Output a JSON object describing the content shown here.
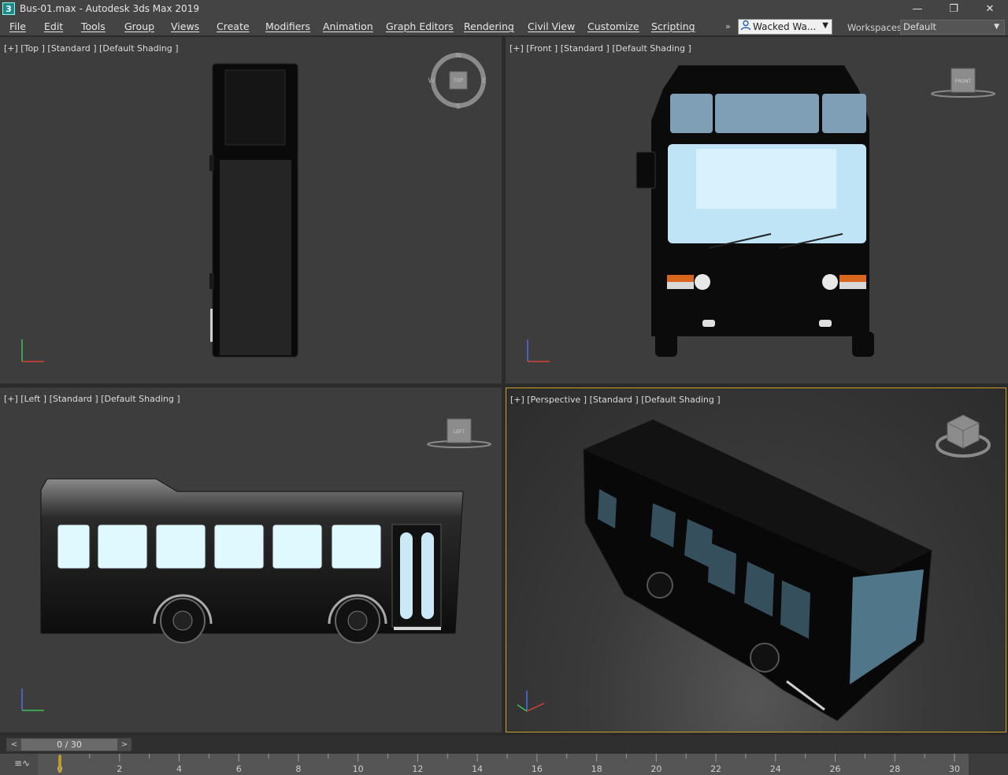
{
  "window": {
    "app_icon_glyph": "3",
    "title": "Bus-01.max - Autodesk 3ds Max 2019",
    "controls": {
      "minimize": "—",
      "maximize": "❐",
      "close": "✕"
    }
  },
  "menu": {
    "items": [
      "File",
      "Edit",
      "Tools",
      "Group",
      "Views",
      "Create",
      "Modifiers",
      "Animation",
      "Graph Editors",
      "Rendering",
      "Civil View",
      "Customize",
      "Scripting"
    ],
    "more": "»",
    "user": "Wacked Wa...",
    "workspaces_label": "Workspaces:",
    "workspace_value": "Default"
  },
  "viewports": {
    "top": {
      "label": "[+] [Top ] [Standard ] [Default Shading ]",
      "gizmo": {
        "n": "N",
        "s": "S",
        "e": "E",
        "w": "W",
        "face": "TOP"
      }
    },
    "front": {
      "label": "[+] [Front ] [Standard ] [Default Shading ]",
      "gizmo_face": "FRONT"
    },
    "left": {
      "label": "[+] [Left ] [Standard ] [Default Shading ]",
      "gizmo_face": "LEFT"
    },
    "perspective": {
      "label": "[+] [Perspective ] [Standard ] [Default Shading ]",
      "active": true
    }
  },
  "timeline": {
    "prev": "<",
    "next": ">",
    "frame_display": "0 / 30",
    "current_frame": 0,
    "total_frames": 30,
    "tick_labels": [
      "0",
      "2",
      "4",
      "6",
      "8",
      "10",
      "12",
      "14",
      "16",
      "18",
      "20",
      "22",
      "24",
      "26",
      "28",
      "30"
    ]
  },
  "colors": {
    "active_border": "#c9a227",
    "axis_x": "#d9413a",
    "axis_y": "#3bc35a",
    "axis_z": "#4a70e0"
  }
}
